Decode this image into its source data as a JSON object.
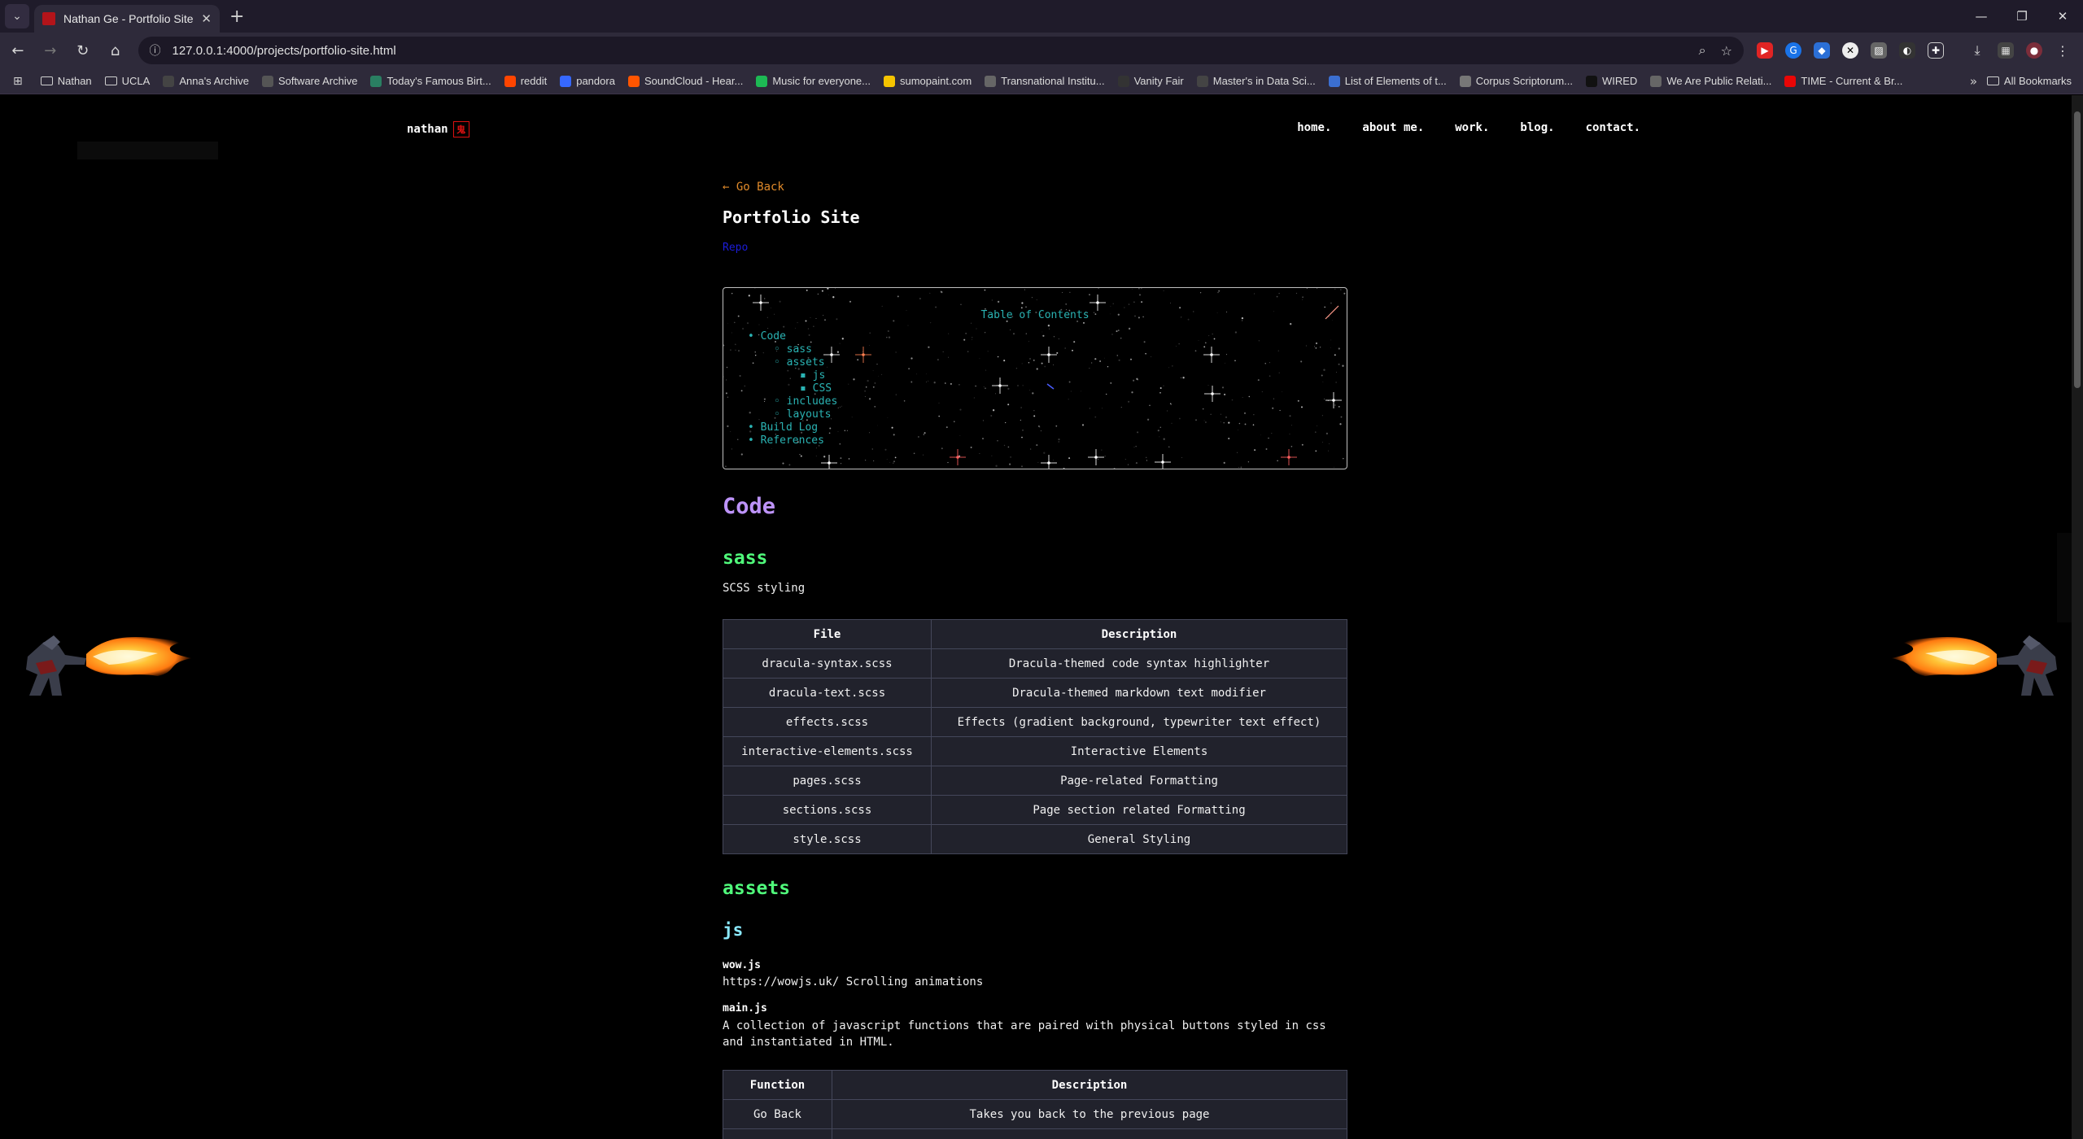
{
  "browser": {
    "tab_title": "Nathan Ge - Portfolio Site",
    "url": "127.0.0.1:4000/projects/portfolio-site.html",
    "bookmarks": [
      {
        "label": "Nathan",
        "icon": "folder-icon",
        "color": "#cfcfcf"
      },
      {
        "label": "UCLA",
        "icon": "folder-icon",
        "color": "#cfcfcf"
      },
      {
        "label": "Anna's Archive",
        "icon": "a-icon",
        "color": "#444444"
      },
      {
        "label": "Software Archive",
        "icon": "archive-icon",
        "color": "#555555"
      },
      {
        "label": "Today's Famous Birt...",
        "icon": "globe-icon",
        "color": "#2a7f62"
      },
      {
        "label": "reddit",
        "icon": "reddit-icon",
        "color": "#ff4500"
      },
      {
        "label": "pandora",
        "icon": "pandora-icon",
        "color": "#3668ff"
      },
      {
        "label": "SoundCloud - Hear...",
        "icon": "soundcloud-icon",
        "color": "#ff5500"
      },
      {
        "label": "Music for everyone...",
        "icon": "spotify-icon",
        "color": "#1db954"
      },
      {
        "label": "sumopaint.com",
        "icon": "sumopaint-icon",
        "color": "#f5c400"
      },
      {
        "label": "Transnational Institu...",
        "icon": "tni-icon",
        "color": "#666666"
      },
      {
        "label": "Vanity Fair",
        "icon": "vf-icon",
        "color": "#333333"
      },
      {
        "label": "Master's in Data Sci...",
        "icon": "mds-icon",
        "color": "#444444"
      },
      {
        "label": "List of Elements of t...",
        "icon": "elements-icon",
        "color": "#3b6fd1"
      },
      {
        "label": "Corpus Scriptorum...",
        "icon": "corpus-icon",
        "color": "#777777"
      },
      {
        "label": "WIRED",
        "icon": "wired-icon",
        "color": "#111111"
      },
      {
        "label": "We Are Public Relati...",
        "icon": "globe-icon",
        "color": "#666666"
      },
      {
        "label": "TIME - Current & Br...",
        "icon": "time-icon",
        "color": "#e90606"
      }
    ],
    "all_bookmarks": "All Bookmarks"
  },
  "site": {
    "logo": "nathan",
    "logo_seal": "鬼",
    "nav": [
      "home.",
      "about me.",
      "work.",
      "blog.",
      "contact."
    ]
  },
  "page": {
    "go_back": "← Go Back",
    "title": "Portfolio Site",
    "repo": "Repo",
    "toc": {
      "title": "Table of Contents",
      "items": [
        {
          "text": "• Code",
          "level": 1
        },
        {
          "text": "◦ sass",
          "level": 2
        },
        {
          "text": "◦ assets",
          "level": 2
        },
        {
          "text": "▪ js",
          "level": 3
        },
        {
          "text": "▪ CSS",
          "level": 3
        },
        {
          "text": "◦ includes",
          "level": 2
        },
        {
          "text": "◦ layouts",
          "level": 2
        },
        {
          "text": "• Build Log",
          "level": 1
        },
        {
          "text": "• References",
          "level": 1
        }
      ]
    },
    "code_heading": "Code",
    "sass": {
      "heading": "sass",
      "description": "SCSS styling",
      "table": {
        "headers": [
          "File",
          "Description"
        ],
        "rows": [
          [
            "dracula-syntax.scss",
            "Dracula-themed code syntax highlighter"
          ],
          [
            "dracula-text.scss",
            "Dracula-themed markdown text modifier"
          ],
          [
            "effects.scss",
            "Effects (gradient background, typewriter text effect)"
          ],
          [
            "interactive-elements.scss",
            "Interactive Elements"
          ],
          [
            "pages.scss",
            "Page-related Formatting"
          ],
          [
            "sections.scss",
            "Page section related Formatting"
          ],
          [
            "style.scss",
            "General Styling"
          ]
        ]
      }
    },
    "assets": {
      "heading": "assets",
      "js_heading": "js",
      "wow_name": "wow.js",
      "wow_desc": "https://wowjs.uk/ Scrolling animations",
      "main_name": "main.js",
      "main_desc": "A collection of javascript functions that are paired with physical buttons styled in css and instantiated in HTML.",
      "table": {
        "headers": [
          "Function",
          "Description"
        ],
        "rows": [
          [
            "Go Back",
            "Takes you back to the previous page"
          ],
          [
            "",
            ""
          ]
        ]
      }
    }
  },
  "colors": {
    "accent_purple": "#bd93f9",
    "accent_green": "#50fa7b",
    "accent_cyan": "#8be9fd",
    "toc_teal": "#2ab3b3",
    "go_back_orange": "#e08a2a",
    "table_bg": "#21222c"
  }
}
